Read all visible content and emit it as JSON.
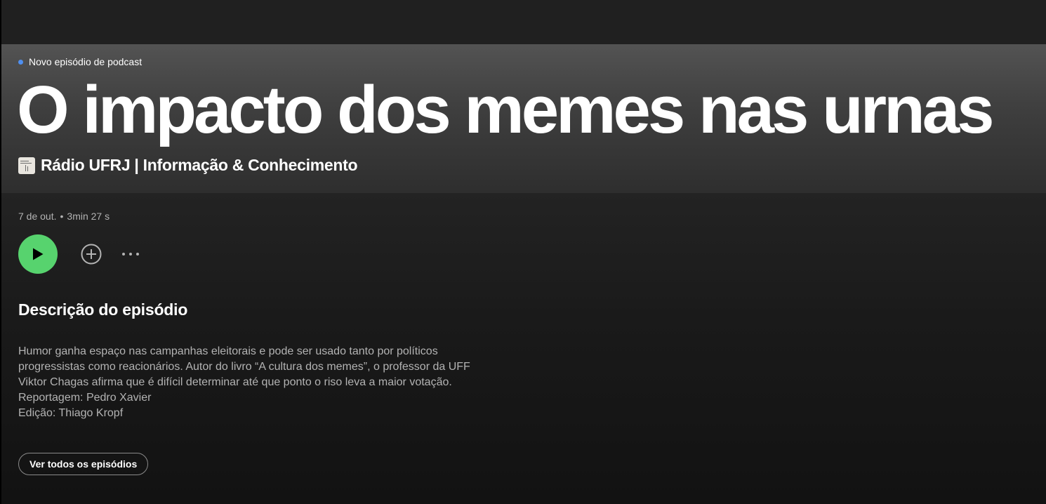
{
  "header": {
    "badge": "Novo episódio de podcast",
    "title": "O impacto dos memes nas urnas",
    "show_name": "Rádio UFRJ | Informação & Conhecimento"
  },
  "meta": {
    "date": "7 de out.",
    "separator": "•",
    "duration": "3min 27 s"
  },
  "actions": {
    "play_icon": "play-icon",
    "add_icon": "plus-circle-icon",
    "more_icon": "more-dots-icon"
  },
  "description": {
    "heading": "Descrição do episódio",
    "lines": [
      "Humor ganha espaço nas campanhas eleitorais e pode ser usado tanto por políticos",
      "progressistas como reacionários. Autor do livro “A cultura dos memes”, o professor da UFF",
      "Viktor Chagas afirma que é difícil determinar até que ponto o riso leva a maior votação.",
      "Reportagem: Pedro Xavier",
      "Edição: Thiago Kropf"
    ]
  },
  "footer": {
    "all_episodes_label": "Ver todos os episódios"
  },
  "colors": {
    "accent_green": "#57d36e",
    "badge_dot_blue": "#4f8ff0",
    "muted_text": "#b3b3b3"
  }
}
